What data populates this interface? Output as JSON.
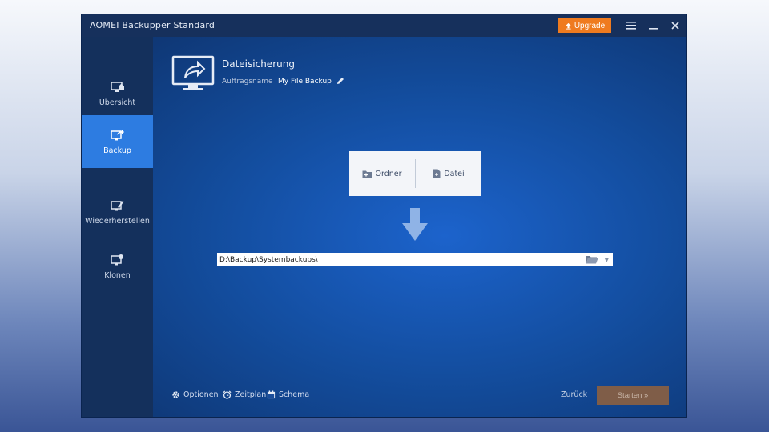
{
  "window": {
    "title": "AOMEI Backupper Standard",
    "upgrade_label": "Upgrade",
    "menu_icon": "hamburger-icon",
    "minimize_icon": "minimize-icon",
    "close_icon": "close-icon"
  },
  "sidebar": {
    "items": [
      {
        "label": "Übersicht",
        "icon": "overview-icon",
        "active": false
      },
      {
        "label": "Backup",
        "icon": "backup-icon",
        "active": true
      },
      {
        "label": "Wiederherstellen",
        "icon": "restore-icon",
        "active": false
      },
      {
        "label": "Klonen",
        "icon": "clone-icon",
        "active": false
      }
    ]
  },
  "main": {
    "section_title": "Dateisicherung",
    "task_label": "Auftragsname",
    "task_name": "My File Backup",
    "source": {
      "folder_label": "Ordner",
      "file_label": "Datei"
    },
    "destination_path": "D:\\Backup\\Systembackups\\"
  },
  "footer": {
    "options_label": "Optionen",
    "schedule_label": "Zeitplan",
    "scheme_label": "Schema",
    "back_label": "Zurück",
    "start_label": "Starten »"
  },
  "colors": {
    "accent": "#2d7ce1",
    "upgrade": "#ef7b1f",
    "start_button": "#7f5d48",
    "titlebar": "#16305c"
  }
}
